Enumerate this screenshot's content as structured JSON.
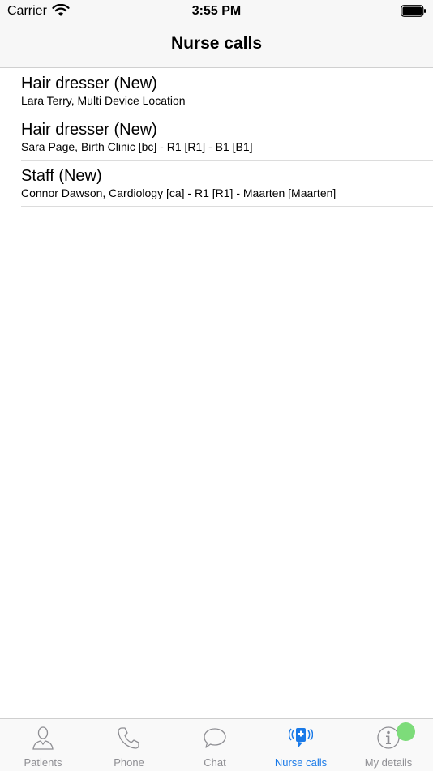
{
  "status_bar": {
    "carrier": "Carrier",
    "time": "3:55 PM",
    "wifi_icon": "wifi-icon",
    "battery_icon": "battery-icon"
  },
  "nav": {
    "title": "Nurse calls"
  },
  "calls": [
    {
      "title": "Hair dresser (New)",
      "subtitle": "Lara Terry, Multi Device Location"
    },
    {
      "title": "Hair dresser (New)",
      "subtitle": "Sara Page, Birth Clinic [bc] - R1 [R1] - B1 [B1]"
    },
    {
      "title": "Staff (New)",
      "subtitle": "Connor Dawson, Cardiology [ca] - R1 [R1] - Maarten [Maarten]"
    }
  ],
  "tabs": [
    {
      "label": "Patients",
      "icon": "person-icon",
      "active": false
    },
    {
      "label": "Phone",
      "icon": "phone-icon",
      "active": false
    },
    {
      "label": "Chat",
      "icon": "chat-bubble-icon",
      "active": false
    },
    {
      "label": "Nurse calls",
      "icon": "nurse-call-icon",
      "active": true
    },
    {
      "label": "My details",
      "icon": "info-icon",
      "active": false
    }
  ],
  "colors": {
    "accent": "#1a7ae8",
    "inactive_tab": "#8e8e93",
    "notification_dot": "#7ddc7a"
  }
}
